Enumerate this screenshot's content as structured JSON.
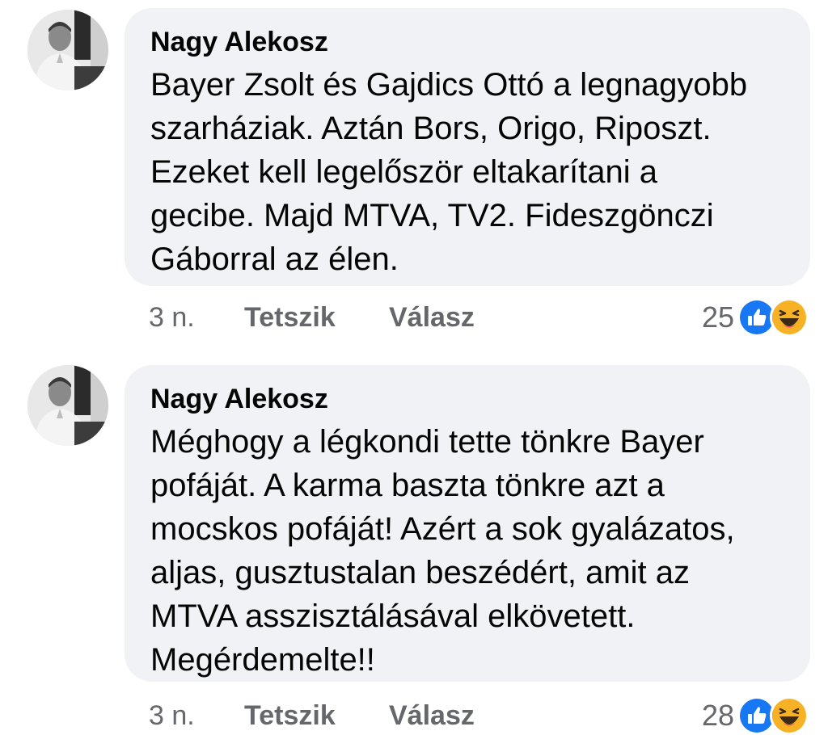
{
  "comments": [
    {
      "author": "Nagy Alekosz",
      "text": "Bayer Zsolt és Gajdics Ottó a legnagyobb\nszarháziak. Aztán Bors, Origo, Riposzt.\nEzeket kell legelőször eltakarítani a\ngecibe. Majd MTVA, TV2. Fideszgönczi\nGáborral az élen.",
      "time": "3 n.",
      "like_label": "Tetszik",
      "reply_label": "Válasz",
      "reaction_count": "25",
      "reactions": [
        "like-icon",
        "haha-icon"
      ]
    },
    {
      "author": "Nagy Alekosz",
      "text": "Méghogy a légkondi tette tönkre Bayer\npofáját. A karma baszta tönkre azt a\nmocskos pofáját! Azért a sok gyalázatos,\naljas, gusztustalan beszédért, amit az\nMTVA asszisztálásával elkövetett.\nMegérdemelte!!",
      "time": "3 n.",
      "like_label": "Tetszik",
      "reply_label": "Válasz",
      "reaction_count": "28",
      "reactions": [
        "like-icon",
        "haha-icon"
      ]
    }
  ],
  "colors": {
    "bubble_bg": "#f0f2f5",
    "secondary_text": "#65676b",
    "like_blue": "#1877f2",
    "haha_yellow": "#f7b125"
  }
}
